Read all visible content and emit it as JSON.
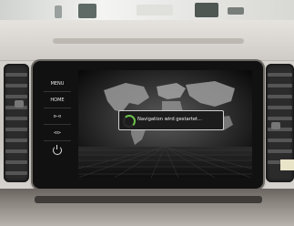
{
  "side_menu": {
    "menu_label": "MENU",
    "home_label": "HOME",
    "next_label": "⊳⊲",
    "back_label": "⊲⊳",
    "power_label": "power"
  },
  "screen": {
    "status_message": "Navigation wird gestartet..."
  },
  "colors": {
    "spinner_accent": "#6cc04a",
    "toast_border": "#cfcfcf"
  }
}
